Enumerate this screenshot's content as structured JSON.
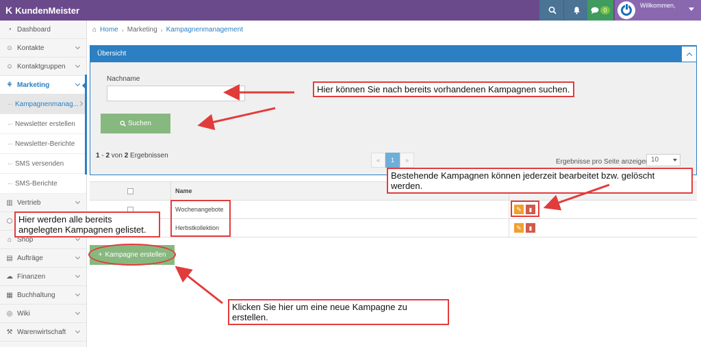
{
  "app": {
    "brand": "KundenMeister",
    "welcome": "Willkommen,",
    "chat_count": "0"
  },
  "sidebar": {
    "items": [
      {
        "label": "Dashboard",
        "icon": "dashboard-icon",
        "glyph": "◔"
      },
      {
        "label": "Kontakte",
        "icon": "contacts-icon",
        "glyph": "☺"
      },
      {
        "label": "Kontaktgruppen",
        "icon": "groups-icon",
        "glyph": "☺"
      },
      {
        "label": "Marketing",
        "icon": "marketing-icon",
        "glyph": "⚘"
      }
    ],
    "sub_items": [
      "Kampagnenmanag...",
      "Newsletter erstellen",
      "Newsletter-Berichte",
      "SMS versenden",
      "SMS-Berichte"
    ],
    "items_lower": [
      {
        "label": "Vertrieb",
        "icon": "sales-icon",
        "glyph": "▥"
      },
      {
        "label": "",
        "icon": "box-icon",
        "glyph": "⬡"
      },
      {
        "label": "Shop",
        "icon": "tag-icon",
        "glyph": "⌂"
      },
      {
        "label": "Aufträge",
        "icon": "orders-icon",
        "glyph": "▤"
      },
      {
        "label": "Finanzen",
        "icon": "finance-icon",
        "glyph": "☁"
      },
      {
        "label": "Buchhaltung",
        "icon": "accounting-icon",
        "glyph": "▦"
      },
      {
        "label": "Wiki",
        "icon": "wiki-icon",
        "glyph": "◎"
      },
      {
        "label": "Warenwirtschaft",
        "icon": "inventory-icon",
        "glyph": "⚒"
      }
    ]
  },
  "breadcrumb": {
    "home": "Home",
    "section": "Marketing",
    "current": "Kampagnenmanagement"
  },
  "panel": {
    "title": "Übersicht",
    "lastname_label": "Nachname",
    "lastname_value": "",
    "search_button": "Suchen",
    "results_from": "1",
    "results_to": "2",
    "results_of": "von",
    "results_total": "2",
    "results_suffix": "Ergebnissen",
    "pager": {
      "prev": "«",
      "page": "1",
      "next": "»"
    },
    "per_page_label": "Ergebnisse pro Seite anzeigen",
    "per_page_value": "10"
  },
  "table": {
    "header_name": "Name",
    "rows": [
      "Wochenangebote",
      "Herbstkollektion"
    ]
  },
  "create_button": "Kampagne erstellen",
  "annotations": {
    "search_hint": "Hier können Sie nach bereits vorhandenen Kampagnen suchen.",
    "edit_hint": "Bestehende Kampagnen können jederzeit bearbeitet bzw. gelöscht werden.",
    "list_hint": "Hier werden alle bereits angelegten Kampagnen gelistet.",
    "create_hint": "Klicken Sie hier um eine neue Kampagne zu erstellen."
  },
  "colors": {
    "topbar": "#6b4a8c",
    "primary": "#2b7fc2",
    "success": "#87b87f",
    "annotation": "#e23b3b"
  }
}
